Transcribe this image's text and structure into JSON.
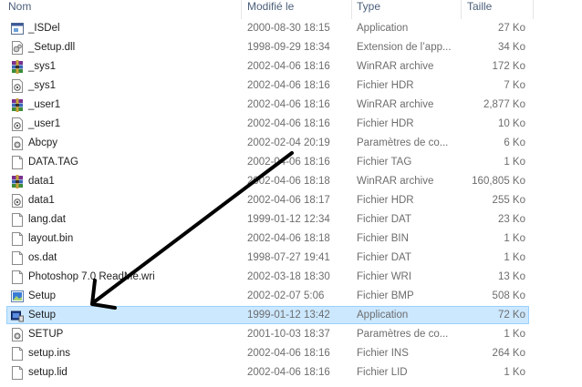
{
  "columns": {
    "name": "Nom",
    "date": "Modifié le",
    "type": "Type",
    "size": "Taille"
  },
  "files": [
    {
      "name": "_ISDel",
      "date": "2000-08-30 18:15",
      "type": "Application",
      "size": "27 Ko",
      "icon": "application-icon"
    },
    {
      "name": "_Setup.dll",
      "date": "1998-09-29 18:34",
      "type": "Extension de l’app...",
      "size": "34 Ko",
      "icon": "dll-icon"
    },
    {
      "name": "_sys1",
      "date": "2002-04-06 18:16",
      "type": "WinRAR archive",
      "size": "172 Ko",
      "icon": "winrar-icon"
    },
    {
      "name": "_sys1",
      "date": "2002-04-06 18:16",
      "type": "Fichier HDR",
      "size": "7 Ko",
      "icon": "hdr-file-icon"
    },
    {
      "name": "_user1",
      "date": "2002-04-06 18:16",
      "type": "WinRAR archive",
      "size": "2,877 Ko",
      "icon": "winrar-icon"
    },
    {
      "name": "_user1",
      "date": "2002-04-06 18:16",
      "type": "Fichier HDR",
      "size": "10 Ko",
      "icon": "hdr-file-icon"
    },
    {
      "name": "Abcpy",
      "date": "2002-02-04 20:19",
      "type": "Paramètres de co...",
      "size": "6 Ko",
      "icon": "settings-file-icon"
    },
    {
      "name": "DATA.TAG",
      "date": "2002-04-06 18:16",
      "type": "Fichier TAG",
      "size": "1 Ko",
      "icon": "blank-file-icon"
    },
    {
      "name": "data1",
      "date": "2002-04-06 18:18",
      "type": "WinRAR archive",
      "size": "160,805 Ko",
      "icon": "winrar-icon"
    },
    {
      "name": "data1",
      "date": "2002-04-06 18:17",
      "type": "Fichier HDR",
      "size": "255 Ko",
      "icon": "hdr-file-icon"
    },
    {
      "name": "lang.dat",
      "date": "1999-01-12 12:34",
      "type": "Fichier DAT",
      "size": "23 Ko",
      "icon": "blank-file-icon"
    },
    {
      "name": "layout.bin",
      "date": "2002-04-06 18:18",
      "type": "Fichier BIN",
      "size": "1 Ko",
      "icon": "blank-file-icon"
    },
    {
      "name": "os.dat",
      "date": "1998-07-27 19:41",
      "type": "Fichier DAT",
      "size": "1 Ko",
      "icon": "blank-file-icon"
    },
    {
      "name": "Photoshop 7.0 ReadMe.wri",
      "date": "2002-03-18 18:30",
      "type": "Fichier WRI",
      "size": "13 Ko",
      "icon": "blank-file-icon"
    },
    {
      "name": "Setup",
      "date": "2002-02-07 5:06",
      "type": "Fichier BMP",
      "size": "508 Ko",
      "icon": "bitmap-icon"
    },
    {
      "name": "Setup",
      "date": "1999-01-12 13:42",
      "type": "Application",
      "size": "72 Ko",
      "icon": "setup-application-icon",
      "selected": true
    },
    {
      "name": "SETUP",
      "date": "2001-10-03 18:37",
      "type": "Paramètres de co...",
      "size": "1 Ko",
      "icon": "settings-file-icon"
    },
    {
      "name": "setup.ins",
      "date": "2002-04-06 18:16",
      "type": "Fichier INS",
      "size": "264 Ko",
      "icon": "blank-file-icon"
    },
    {
      "name": "setup.lid",
      "date": "2002-04-06 18:16",
      "type": "Fichier LID",
      "size": "1 Ko",
      "icon": "blank-file-icon"
    }
  ],
  "colors": {
    "selection_fill": "#cce8ff",
    "selection_border": "#99d1ff",
    "arrow": "#000000",
    "header_text": "#4c607a"
  }
}
